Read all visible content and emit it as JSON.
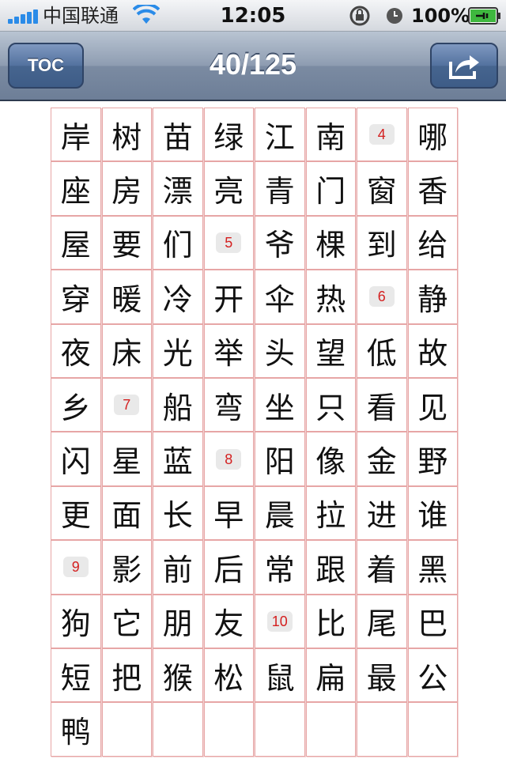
{
  "status_bar": {
    "carrier": "中国联通",
    "time": "12:05",
    "battery_percent": "100%",
    "signal_bars": 5
  },
  "nav": {
    "toc_label": "TOC",
    "title": "40/125",
    "share_icon": "share-icon"
  },
  "colors": {
    "nav_bar": "#8e9cb1",
    "button": "#4d6c98",
    "grid_border": "#e7a6a6",
    "lesson_number": "#d42020"
  },
  "grid": {
    "columns": 8,
    "rows": [
      [
        "岸",
        "树",
        "苗",
        "绿",
        "江",
        "南",
        {
          "n": "4"
        },
        "哪"
      ],
      [
        "座",
        "房",
        "漂",
        "亮",
        "青",
        "门",
        "窗",
        "香"
      ],
      [
        "屋",
        "要",
        "们",
        {
          "n": "5"
        },
        "爷",
        "棵",
        "到",
        "给"
      ],
      [
        "穿",
        "暖",
        "冷",
        "开",
        "伞",
        "热",
        {
          "n": "6"
        },
        "静"
      ],
      [
        "夜",
        "床",
        "光",
        "举",
        "头",
        "望",
        "低",
        "故"
      ],
      [
        "乡",
        {
          "n": "7"
        },
        "船",
        "弯",
        "坐",
        "只",
        "看",
        "见"
      ],
      [
        "闪",
        "星",
        "蓝",
        {
          "n": "8"
        },
        "阳",
        "像",
        "金",
        "野"
      ],
      [
        "更",
        "面",
        "长",
        "早",
        "晨",
        "拉",
        "进",
        "谁"
      ],
      [
        {
          "n": "9"
        },
        "影",
        "前",
        "后",
        "常",
        "跟",
        "着",
        "黑"
      ],
      [
        "狗",
        "它",
        "朋",
        "友",
        {
          "n": "10"
        },
        "比",
        "尾",
        "巴"
      ],
      [
        "短",
        "把",
        "猴",
        "松",
        "鼠",
        "扁",
        "最",
        "公"
      ],
      [
        "鸭",
        "",
        "",
        "",
        "",
        "",
        "",
        ""
      ]
    ]
  }
}
